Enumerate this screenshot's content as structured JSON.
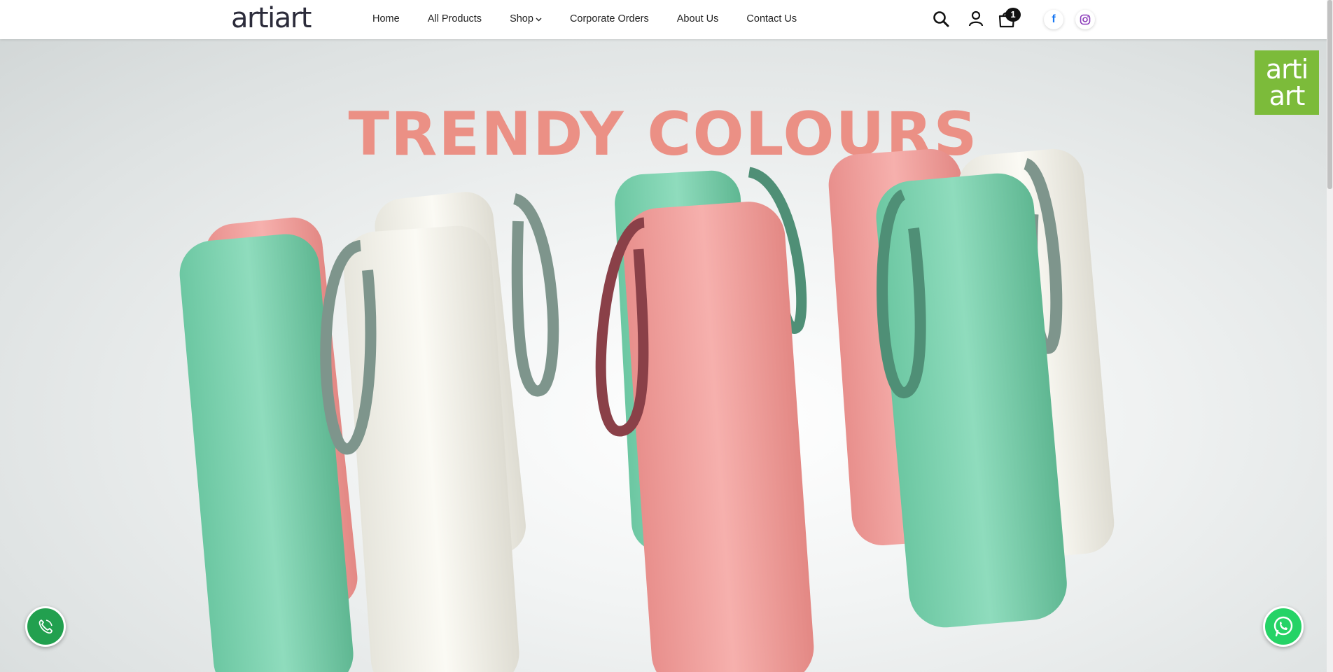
{
  "brand": {
    "logo_text": "artiart",
    "corner_logo_line1": "arti",
    "corner_logo_line2": "art"
  },
  "nav": {
    "items": [
      {
        "label": "Home"
      },
      {
        "label": "All Products"
      },
      {
        "label": "Shop",
        "has_dropdown": true
      },
      {
        "label": "Corporate Orders"
      },
      {
        "label": "About Us"
      },
      {
        "label": "Contact Us"
      }
    ]
  },
  "header_icons": {
    "search": "search-icon",
    "account": "user-icon",
    "cart": "cart-icon",
    "cart_count": "1",
    "facebook": "facebook-icon",
    "facebook_glyph": "f",
    "instagram": "instagram-icon"
  },
  "hero": {
    "title": "TRENDY COLOURS",
    "colors": {
      "mint": "#7fd3b2",
      "pink": "#f0a3a0",
      "white": "#f4f3ec",
      "strap_grey": "#7e958c",
      "strap_dark": "#8a4048",
      "title": "#ec8c80"
    }
  },
  "floating": {
    "call": "phone-icon",
    "whatsapp": "whatsapp-icon"
  },
  "colors": {
    "corner_logo_bg": "#7cbb3a",
    "call_bg": "#22a04f",
    "whatsapp_bg": "#25d366"
  }
}
